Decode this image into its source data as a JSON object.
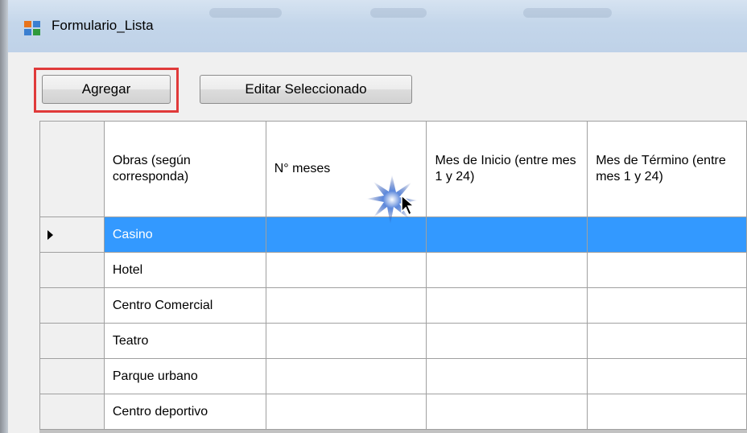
{
  "window": {
    "title": "Formulario_Lista"
  },
  "toolbar": {
    "add_label": "Agregar",
    "edit_label": "Editar Seleccionado"
  },
  "grid": {
    "headers": [
      "Obras (según corresponda)",
      "N° meses",
      "Mes de Inicio (entre mes 1 y 24)",
      "Mes de Término (entre mes 1 y 24)"
    ],
    "rows": [
      {
        "obra": "Casino",
        "meses": "",
        "inicio": "",
        "termino": ""
      },
      {
        "obra": "Hotel",
        "meses": "",
        "inicio": "",
        "termino": ""
      },
      {
        "obra": "Centro Comercial",
        "meses": "",
        "inicio": "",
        "termino": ""
      },
      {
        "obra": "Teatro",
        "meses": "",
        "inicio": "",
        "termino": ""
      },
      {
        "obra": "Parque urbano",
        "meses": "",
        "inicio": "",
        "termino": ""
      },
      {
        "obra": "Centro deportivo",
        "meses": "",
        "inicio": "",
        "termino": ""
      }
    ],
    "selected_row": 0
  },
  "colors": {
    "selection": "#3399ff",
    "focus_highlight": "#e03a3a"
  }
}
